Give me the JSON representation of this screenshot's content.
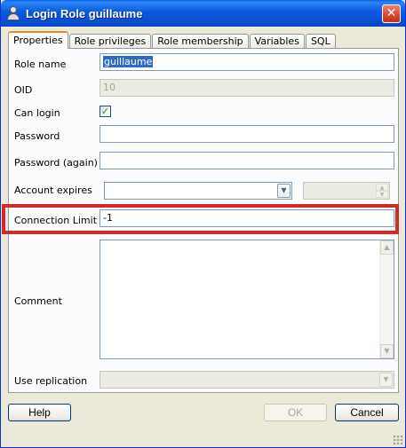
{
  "window": {
    "title": "Login Role guillaume",
    "close_glyph": "✕"
  },
  "tabs": [
    {
      "label": "Properties",
      "active": true
    },
    {
      "label": "Role privileges"
    },
    {
      "label": "Role membership"
    },
    {
      "label": "Variables"
    },
    {
      "label": "SQL"
    }
  ],
  "form": {
    "role_name": {
      "label": "Role name",
      "value": "guillaume"
    },
    "oid": {
      "label": "OID",
      "value": "10"
    },
    "can_login": {
      "label": "Can login",
      "checked": true,
      "glyph": "✓"
    },
    "password": {
      "label": "Password",
      "value": ""
    },
    "password_again": {
      "label": "Password (again)",
      "value": ""
    },
    "account_expires": {
      "label": "Account expires",
      "value": "",
      "time_value": ""
    },
    "connection_limit": {
      "label": "Connection Limit",
      "value": "-1"
    },
    "comment": {
      "label": "Comment",
      "value": ""
    },
    "use_replication": {
      "label": "Use replication",
      "value": ""
    }
  },
  "buttons": {
    "help": "Help",
    "ok": "OK",
    "cancel": "Cancel"
  },
  "icons": {
    "combo_arrow": "▼",
    "up_arrow": "▲",
    "down_arrow": "▼"
  },
  "colors": {
    "highlight_border": "#d02a2a",
    "selection": "#316ac5",
    "active_tab_accent": "#e68b2c"
  }
}
